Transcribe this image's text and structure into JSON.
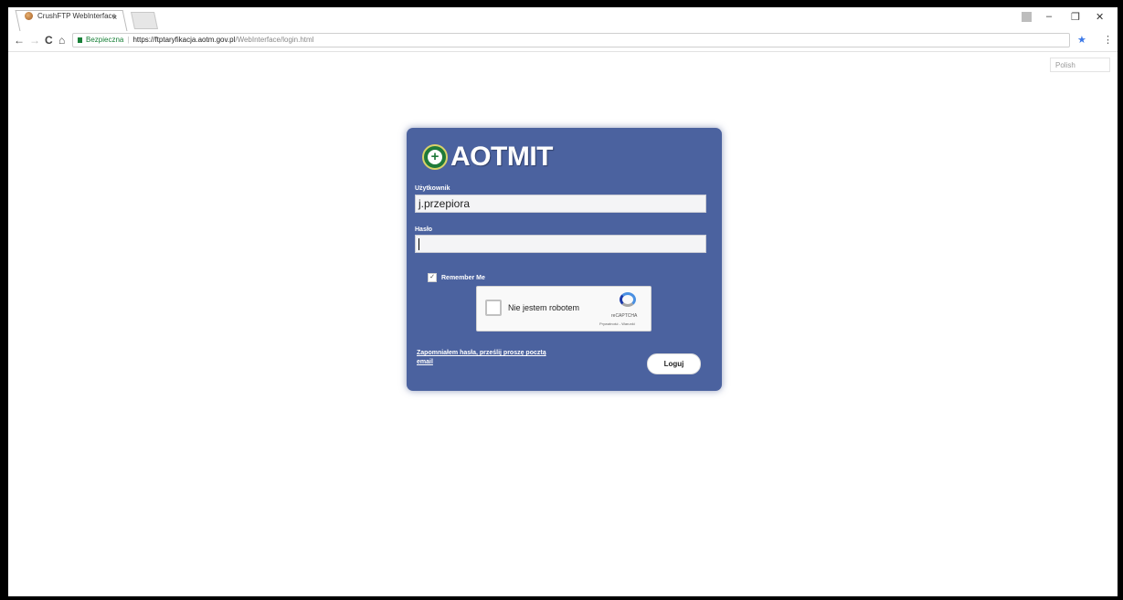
{
  "browser": {
    "tab_title": "CrushFTP WebInterface",
    "tab_close": "×",
    "user_icon": "person-icon",
    "minimize": "–",
    "restore": "❐",
    "close": "✕",
    "back": "←",
    "forward": "→",
    "reload": "C",
    "home": "⌂",
    "secure_label": "Bezpieczna",
    "separator": "|",
    "url_main": "https://ftptaryfikacja.aotm.gov.pl",
    "url_path": "/WebInterface/login.html",
    "bookmark_star": "★",
    "menu": "⋮"
  },
  "language": {
    "selected": "Polish"
  },
  "login": {
    "logo_text": "AOTMIT",
    "username_label": "Użytkownik",
    "username_value": "j.przepiora",
    "password_label": "Hasło",
    "password_value": "",
    "remember_checked_mark": "✓",
    "remember_label": "Remember Me",
    "captcha_label": "Nie jestem robotem",
    "captcha_brand": "reCAPTCHA",
    "captcha_links": "Prywatność - Warunki",
    "forgot_link": "Zapomniałem hasła, prześlij proszę pocztą email",
    "login_button": "Loguj"
  },
  "colors": {
    "panel": "#4b629f",
    "secure": "#188038",
    "star": "#3b78e7"
  }
}
